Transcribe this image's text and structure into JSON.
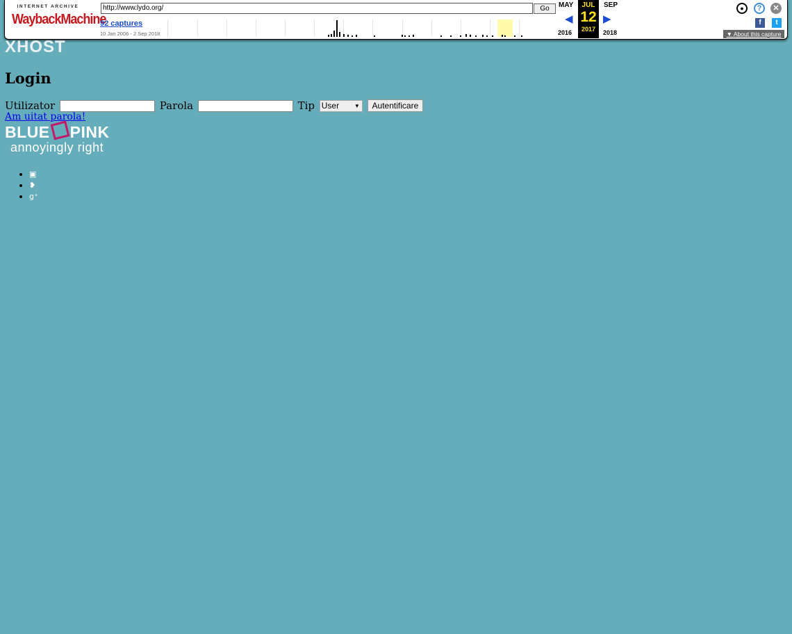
{
  "wayback": {
    "logo_top": "INTERNET ARCHIVE",
    "logo_main": "WaybackMachine",
    "url": "http://www.lydo.org/",
    "go_label": "Go",
    "captures": "92 captures",
    "date_range": "10 Jan 2006 - 2 Sep 2018",
    "prev_month": "MAY",
    "cur_month": "JUL",
    "next_month": "SEP",
    "cur_day": "12",
    "prev_year": "2016",
    "cur_year": "2017",
    "next_year": "2018",
    "about": "About this capture",
    "icons": [
      "user-icon",
      "help-icon",
      "close-icon",
      "facebook-icon",
      "twitter-icon"
    ],
    "accent": "#1a4bd1",
    "highlight": "#ffe01b"
  },
  "page": {
    "site_logo": "XHOST",
    "title": "Login",
    "form": {
      "user_label": "Utilizator",
      "user_value": "",
      "pass_label": "Parola",
      "pass_value": "",
      "type_label": "Tip",
      "type_value": "User",
      "submit_label": "Autentificare"
    },
    "forgot_link": "Am uitat parola!",
    "brand_left": "BLUE",
    "brand_right": "PINK",
    "brand_tagline": "annoyingly right",
    "social_icons": [
      "broken-image-icon",
      "twitter-icon",
      "google-plus-icon"
    ],
    "background": "#66adbb",
    "brand_accent": "#c2196d"
  }
}
